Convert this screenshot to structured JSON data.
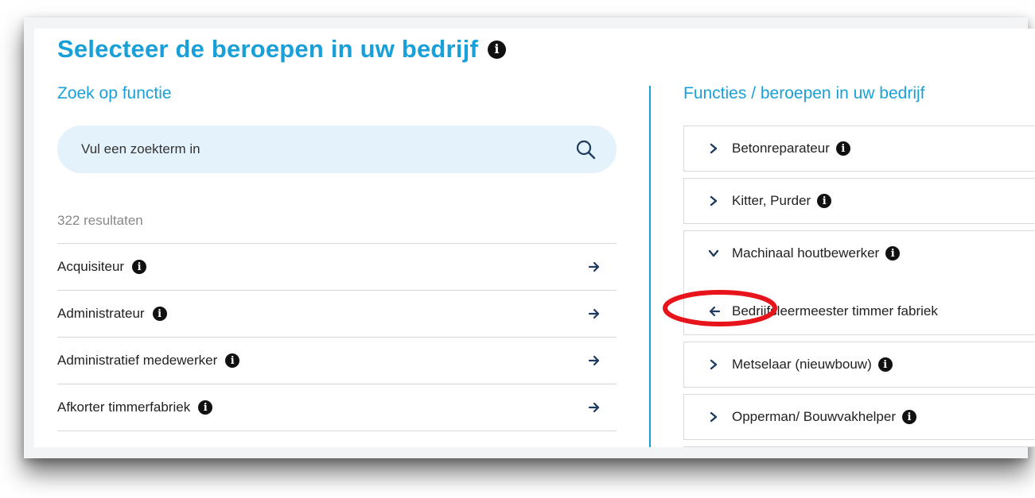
{
  "page": {
    "title": "Selecteer de beroepen in uw bedrijf"
  },
  "left": {
    "heading": "Zoek op functie",
    "search": {
      "placeholder": "Vul een zoekterm in",
      "value": ""
    },
    "results_count": "322 resultaten",
    "results": [
      {
        "label": "Acquisiteur"
      },
      {
        "label": "Administrateur"
      },
      {
        "label": "Administratief medewerker"
      },
      {
        "label": "Afkorter timmerfabriek"
      }
    ]
  },
  "right": {
    "heading": "Functies / beroepen in uw bedrijf",
    "items": [
      {
        "label": "Betonreparateur"
      },
      {
        "label": "Kitter, Purder"
      },
      {
        "label": "Machinaal houtbewerker"
      },
      {
        "label": "Metselaar (nieuwbouw)"
      },
      {
        "label": "Opperman/ Bouwvakhelper"
      }
    ],
    "sub_item": {
      "label": "Bedrijfsleermeester timmer fabriek"
    }
  },
  "icons": {
    "info": "info-circle-icon",
    "search": "search-icon",
    "arrow_right": "arrow-right-icon",
    "arrow_left": "arrow-left-icon",
    "chevron_right": "chevron-right-icon",
    "chevron_down": "chevron-down-icon"
  },
  "colors": {
    "accent": "#1aa0d8",
    "search_bg": "#e4f2fb",
    "arrow": "#1f3a5f",
    "annotation": "#e8141b"
  }
}
